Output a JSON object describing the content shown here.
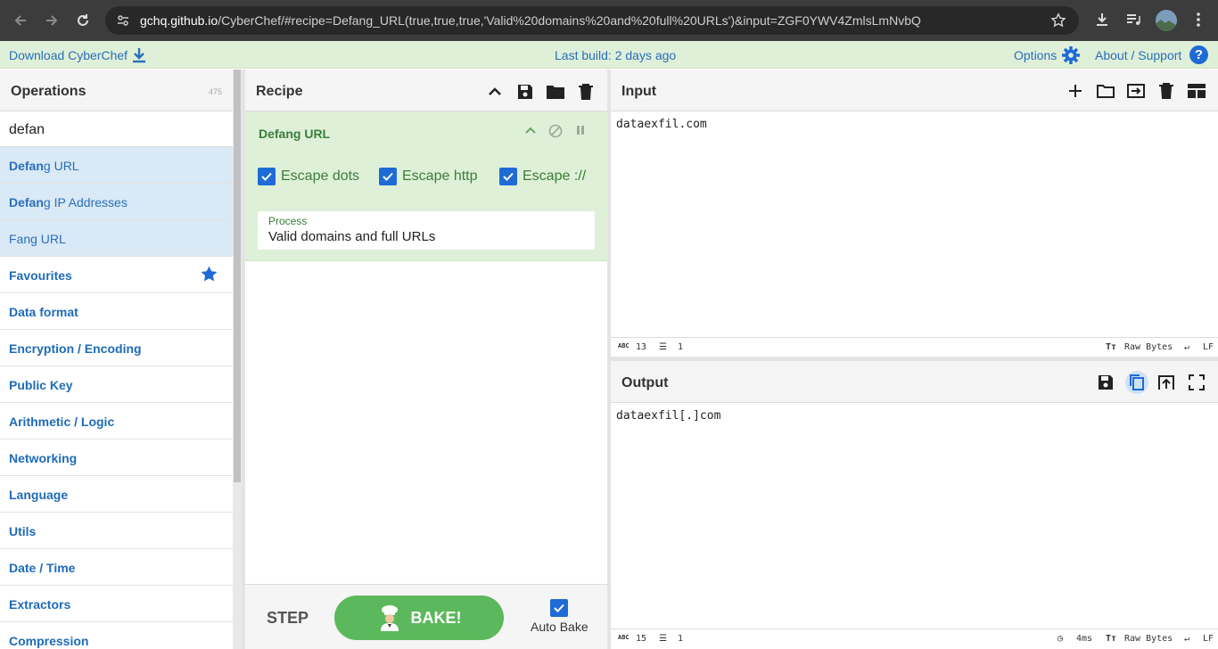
{
  "browser": {
    "url_host": "gchq.github.io",
    "url_rest": "/CyberChef/#recipe=Defang_URL(true,true,true,'Valid%20domains%20and%20full%20URLs')&input=ZGF0YWV4ZmlsLmNvbQ"
  },
  "banner": {
    "download": "Download CyberChef",
    "last_build": "Last build: 2 days ago",
    "options": "Options",
    "about": "About / Support"
  },
  "operations": {
    "title": "Operations",
    "count": "475",
    "search_value": "defan",
    "results": [
      {
        "match": "Defan",
        "rest": "g URL"
      },
      {
        "match": "Defan",
        "rest": "g IP Addresses"
      },
      {
        "match": "",
        "rest": "Fang URL"
      }
    ],
    "categories": [
      "Favourites",
      "Data format",
      "Encryption / Encoding",
      "Public Key",
      "Arithmetic / Logic",
      "Networking",
      "Language",
      "Utils",
      "Date / Time",
      "Extractors",
      "Compression"
    ]
  },
  "recipe": {
    "title": "Recipe",
    "operation": "Defang URL",
    "options": [
      "Escape dots",
      "Escape http",
      "Escape ://"
    ],
    "process_label": "Process",
    "process_value": "Valid domains and full URLs",
    "step": "STEP",
    "bake": "BAKE!",
    "auto_bake": "Auto Bake"
  },
  "input": {
    "title": "Input",
    "text": "dataexfil.com",
    "length": "13",
    "lines": "1",
    "encoding": "Raw Bytes",
    "eol": "LF"
  },
  "output": {
    "title": "Output",
    "text": "dataexfil[.]com",
    "length": "15",
    "lines": "1",
    "time": "4ms",
    "encoding": "Raw Bytes",
    "eol": "LF"
  },
  "colors": {
    "link_blue": "#2a6ebb",
    "banner_green": "#dff0d8",
    "recipe_green": "#3a7d3a",
    "bake_green": "#5cb85c",
    "checkbox_blue": "#1e6bd6"
  }
}
